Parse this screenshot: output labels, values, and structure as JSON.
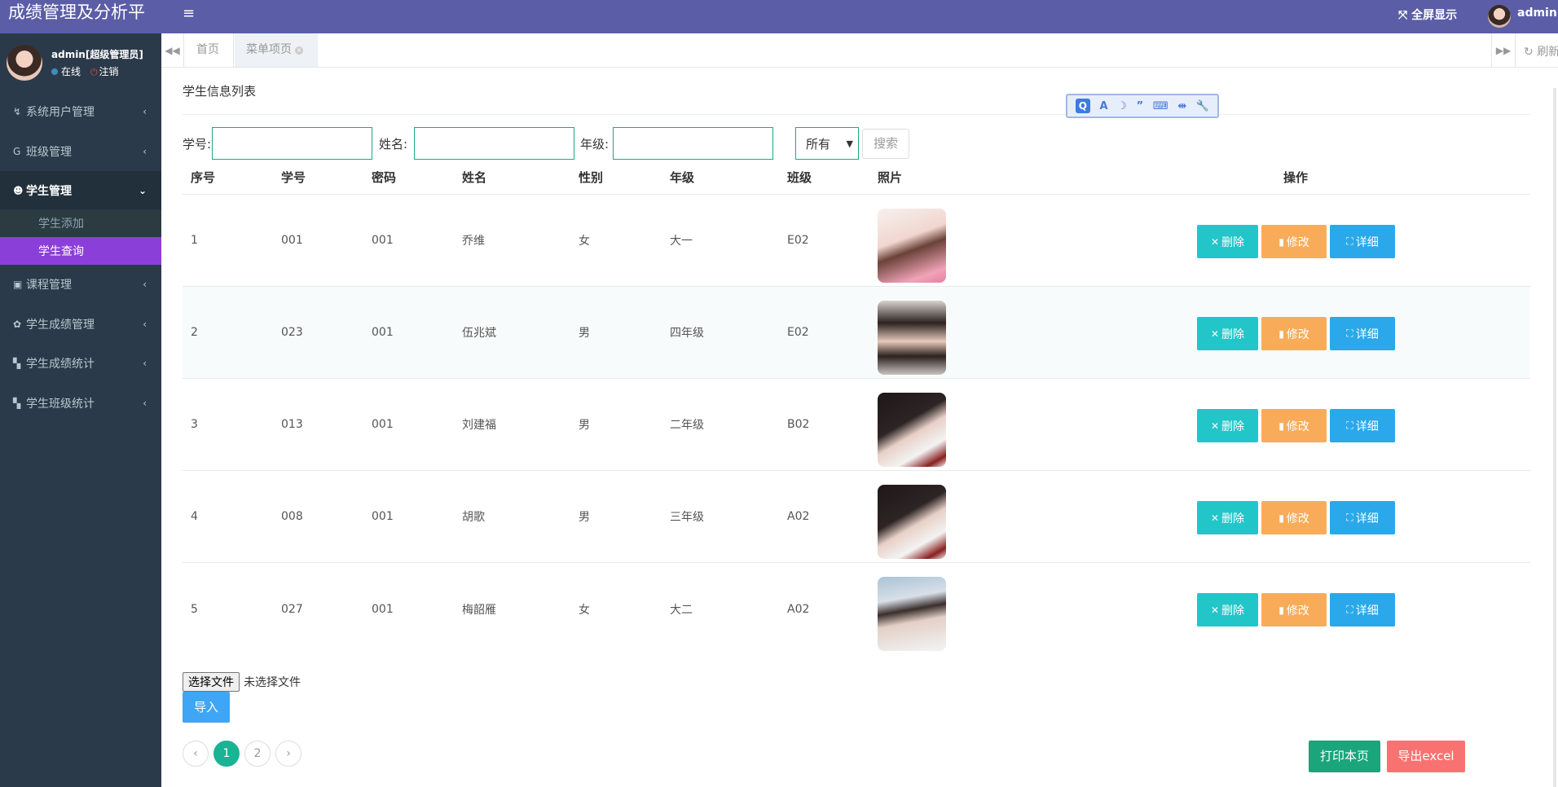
{
  "app": {
    "title": "成绩管理及分析平"
  },
  "topbar": {
    "menu_icon": "hamburger-icon",
    "fullscreen_label": "全屏显示",
    "user_name": "admin"
  },
  "user_panel": {
    "name": "admin[超级管理员]",
    "status_online": "在线",
    "logout": "注销"
  },
  "sidebar": {
    "items": [
      {
        "label": "系统用户管理",
        "icon": "↯"
      },
      {
        "label": "班级管理",
        "icon": "G"
      },
      {
        "label": "学生管理",
        "icon": "☻"
      },
      {
        "label": "课程管理",
        "icon": "▣"
      },
      {
        "label": "学生成绩管理",
        "icon": "✿"
      },
      {
        "label": "学生成绩统计",
        "icon": "▚"
      },
      {
        "label": "学生班级统计",
        "icon": "▚"
      }
    ],
    "sub_items": [
      {
        "label": "学生添加"
      },
      {
        "label": "学生查询"
      }
    ]
  },
  "tabs": {
    "home": "首页",
    "active": "菜单项页",
    "refresh": "刷新"
  },
  "page": {
    "title": "学生信息列表"
  },
  "search": {
    "student_no_label": "学号:",
    "name_label": "姓名:",
    "grade_label": "年级:",
    "grade_selected": "所有",
    "search_button": "搜索"
  },
  "table": {
    "headers": [
      "序号",
      "学号",
      "密码",
      "姓名",
      "性别",
      "年级",
      "班级",
      "照片",
      "操作"
    ],
    "rows": [
      {
        "seq": "1",
        "no": "001",
        "pwd": "001",
        "name": "乔维",
        "gender": "女",
        "grade": "大一",
        "class": "E02"
      },
      {
        "seq": "2",
        "no": "023",
        "pwd": "001",
        "name": "伍兆斌",
        "gender": "男",
        "grade": "四年级",
        "class": "E02"
      },
      {
        "seq": "3",
        "no": "013",
        "pwd": "001",
        "name": "刘建福",
        "gender": "男",
        "grade": "二年级",
        "class": "B02"
      },
      {
        "seq": "4",
        "no": "008",
        "pwd": "001",
        "name": "胡歌",
        "gender": "男",
        "grade": "三年级",
        "class": "A02"
      },
      {
        "seq": "5",
        "no": "027",
        "pwd": "001",
        "name": "梅韶雁",
        "gender": "女",
        "grade": "大二",
        "class": "A02"
      }
    ],
    "actions": {
      "delete": "删除",
      "edit": "修改",
      "detail": "详细"
    }
  },
  "file": {
    "choose": "选择文件",
    "none": "未选择文件",
    "import": "导入"
  },
  "pager": {
    "pages": [
      "1",
      "2"
    ],
    "current": "1"
  },
  "footer": {
    "print": "打印本页",
    "export": "导出excel"
  },
  "colors": {
    "brand": "#5b5ea6",
    "sidebar": "#2b3a4a",
    "selected_sub": "#8b3fd9",
    "teal": "#23c6c8",
    "orange": "#f8ac59",
    "blue": "#2aa8ea"
  }
}
